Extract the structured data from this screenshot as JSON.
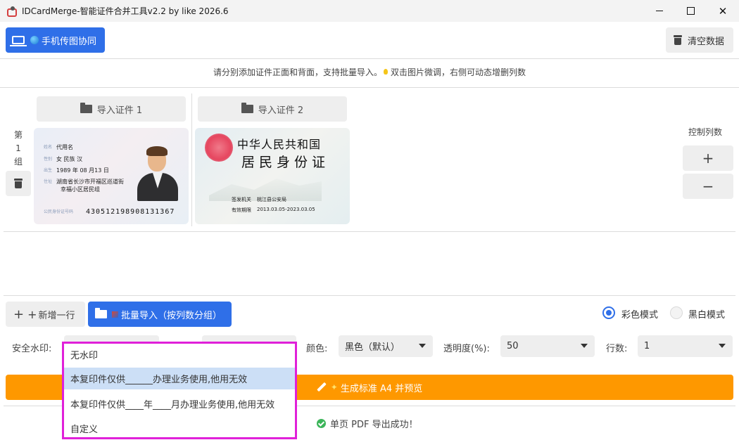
{
  "window": {
    "title": "IDCardMerge-智能证件合并工具v2.2 by like 2026.6"
  },
  "toolbar": {
    "phone_label": "手机传图协同",
    "clear_label": "清空数据"
  },
  "hint": {
    "text_before": "请分别添加证件正面和背面，支持批量导入。",
    "text_after": "双击图片微调，右侧可动态增删列数"
  },
  "group": {
    "label": "第1组"
  },
  "imports": [
    {
      "label": "导入证件 1"
    },
    {
      "label": "导入证件 2"
    }
  ],
  "card_front": {
    "rows": [
      {
        "key": "姓名",
        "value": "代用名"
      },
      {
        "key": "性别",
        "value": "女    民族  汉"
      },
      {
        "key": "出生",
        "value": "1989  年  08  月13  日"
      },
      {
        "key": "住址",
        "value": "湖南省长沙市开福区巡道街"
      },
      {
        "key": "",
        "value": "幸福小区居民组"
      }
    ],
    "id_key": "公民身份证号码",
    "id_number": "430512198908131367"
  },
  "card_back": {
    "title_line1": "中华人民共和国",
    "title_line2": "居民身份证",
    "authority_key": "签发机关",
    "authority_value": "桃江县公安局",
    "validity_key": "有效期限",
    "validity_value": "2013.03.05-2023.03.05"
  },
  "columns": {
    "label": "控制列数",
    "add": "+",
    "remove": "−"
  },
  "actions": {
    "add_row": "新增一行",
    "batch_import": "批量导入（按列数分组）"
  },
  "mode": {
    "color": "彩色模式",
    "bw": "黑白模式",
    "selected": "color"
  },
  "settings": {
    "watermark_label": "安全水印:",
    "color_label": "颜色:",
    "color_value": "黑色（默认）",
    "opacity_label": "透明度(%):",
    "opacity_value": "50",
    "rows_label": "行数:",
    "rows_value": "1"
  },
  "generate": {
    "label": "生成标准 A4 并预览"
  },
  "status": {
    "text": "单页 PDF 导出成功！"
  },
  "watermark_options": [
    {
      "label": "无水印",
      "selected": false
    },
    {
      "label": "本复印件仅供______办理业务使用,他用无效",
      "selected": true
    },
    {
      "label": "本复印件仅供____年____月办理业务使用,他用无效",
      "selected": false
    },
    {
      "label": "自定义",
      "selected": false
    }
  ],
  "colors": {
    "primary": "#2f6fe8",
    "accent": "#fe9800",
    "highlight": "#e020d9",
    "selected_item": "#ccdff6"
  }
}
